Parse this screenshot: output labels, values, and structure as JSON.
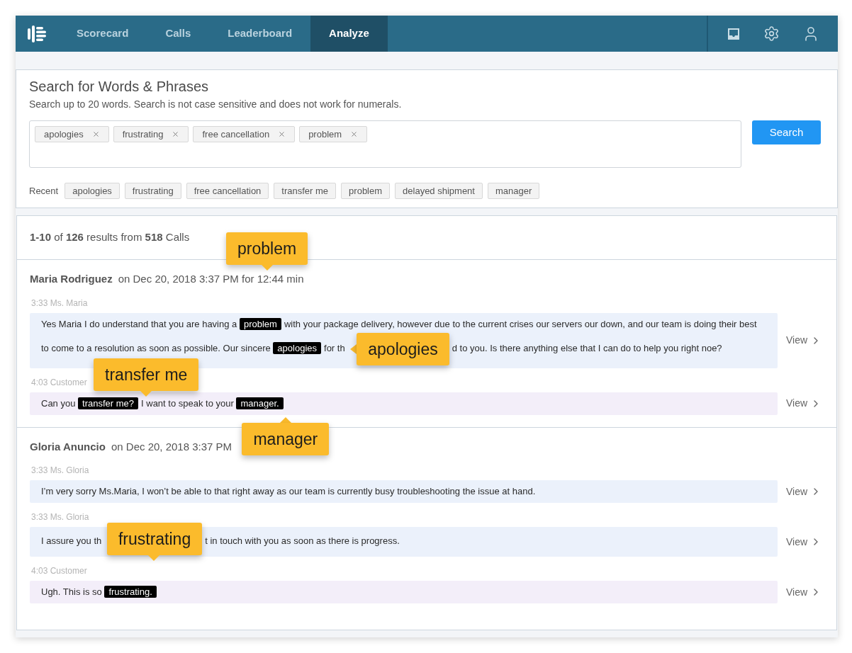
{
  "nav": {
    "tabs": [
      {
        "label": "Scorecard",
        "selected": false
      },
      {
        "label": "Calls",
        "selected": false
      },
      {
        "label": "Leaderboard",
        "selected": false
      },
      {
        "label": "Analyze",
        "selected": true
      }
    ]
  },
  "search": {
    "title": "Search for Words & Phrases",
    "hint": "Search up to 20 words. Search is not case sensitive and does not work for numerals.",
    "terms": [
      "apologies",
      "frustrating",
      "free cancellation",
      "problem"
    ],
    "button": "Search",
    "recent_label": "Recent",
    "recent": [
      "apologies",
      "frustrating",
      "free cancellation",
      "transfer me",
      "problem",
      "delayed shipment",
      "manager"
    ]
  },
  "results": {
    "summary": "**1-10** of **126** results from **518** Calls",
    "calls": [
      {
        "name": "Maria Rodriguez",
        "info": "on Dec 20, 2018 3:37 PM for 12:44 min",
        "callout": "problem",
        "messages": [
          {
            "label": "3:33 Ms. Maria",
            "kind": "agent",
            "view": "View",
            "segments": [
              {
                "kind": "text",
                "text": "Yes Maria I do understand that you are having a"
              },
              {
                "kind": "highlight",
                "text": "problem"
              },
              {
                "kind": "text",
                "text": "with your package delivery, however due to the current crises our servers our down, and our team is doing their best to come to a resolution as soon as possible. Our sincere"
              },
              {
                "kind": "highlight",
                "text": "apologies"
              },
              {
                "kind": "text",
                "text": "for th"
              },
              {
                "kind": "callout",
                "text": "apologies"
              },
              {
                "kind": "text",
                "text": "d to you. Is there anything else that I can do to help you right noe?"
              }
            ]
          },
          {
            "label": "4:03 Customer",
            "kind": "customer",
            "view": "View",
            "segments": [
              {
                "kind": "text",
                "text": "Can you"
              },
              {
                "kind": "highlight-tip-above",
                "text": "transfer me?",
                "callout": "transfer me"
              },
              {
                "kind": "text",
                "text": "I want to speak to your"
              },
              {
                "kind": "highlight-tip-below",
                "text": "manager.",
                "callout": "manager"
              }
            ]
          }
        ]
      },
      {
        "name": "Gloria Anuncio",
        "info": "on Dec 20, 2018 3:37 PM",
        "messages": [
          {
            "label": "3:33 Ms. Gloria",
            "kind": "agent",
            "view": "View",
            "segments": [
              {
                "kind": "text",
                "text": "I’m very sorry Ms.Maria, I won’t be able to that right away as our team is currently busy troubleshooting the issue at hand."
              }
            ]
          },
          {
            "label": "3:33 Ms. Gloria",
            "kind": "agent",
            "view": "View",
            "segments": [
              {
                "kind": "text",
                "text": "I assure you th"
              },
              {
                "kind": "callout-pointing-down",
                "text": "frustrating"
              },
              {
                "kind": "text",
                "text": "t in touch with you as soon as there is progress."
              }
            ]
          },
          {
            "label": "4:03 Customer",
            "kind": "customer",
            "view": "View",
            "segments": [
              {
                "kind": "text",
                "text": "Ugh. This is so"
              },
              {
                "kind": "highlight",
                "text": "frustrating."
              }
            ]
          }
        ]
      }
    ]
  }
}
